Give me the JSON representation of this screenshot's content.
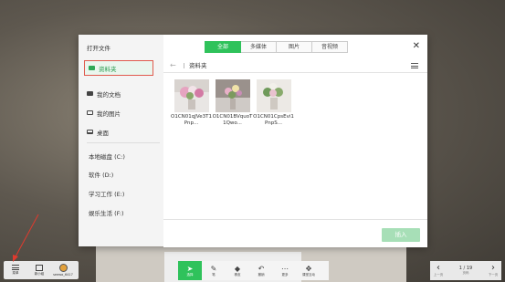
{
  "dialog": {
    "title": "打开文件",
    "sidebar": {
      "active_item": "资料夹",
      "items": [
        "我的文档",
        "我的图片",
        "桌面"
      ],
      "drives": [
        "本地磁盘 (C:)",
        "软件 (D:)",
        "学习工作 (E:)",
        "娱乐生活 (F:)"
      ]
    },
    "tabs": [
      "全部",
      "多媒体",
      "图片",
      "音视频"
    ],
    "active_tab": "全部",
    "path": "资料夹",
    "files": [
      {
        "name": "O1CN01qJVe3T1Pnp..."
      },
      {
        "name": "O1CN01BVquoT1Qwo..."
      },
      {
        "name": "O1CN01CpsEvi1PnpS..."
      }
    ],
    "insert_label": "插入"
  },
  "bottom_left": {
    "items": [
      {
        "label": "菜单",
        "icon": "menu-icon"
      },
      {
        "label": "新小组",
        "icon": "board-icon"
      },
      {
        "label": "seewo_6417",
        "icon": "avatar-icon"
      }
    ]
  },
  "bottom_center": {
    "items": [
      {
        "label": "选择",
        "icon": "cursor-icon",
        "glyph": "➤"
      },
      {
        "label": "笔",
        "icon": "pen-icon",
        "glyph": "✎"
      },
      {
        "label": "橡皮",
        "icon": "eraser-icon",
        "glyph": "◆"
      },
      {
        "label": "撤销",
        "icon": "undo-icon",
        "glyph": "↶"
      },
      {
        "label": "更多",
        "icon": "more-icon",
        "glyph": "⋯"
      },
      {
        "label": "课堂互动",
        "icon": "interact-icon",
        "glyph": "✥"
      }
    ]
  },
  "pager": {
    "page": "1 / 19",
    "prev_label": "上一页",
    "mid_label": "页码",
    "next_label": "下一页"
  },
  "colors": {
    "accent": "#2fc25b",
    "highlight_border": "#e05a4e",
    "annotation": "#e03a2e"
  }
}
